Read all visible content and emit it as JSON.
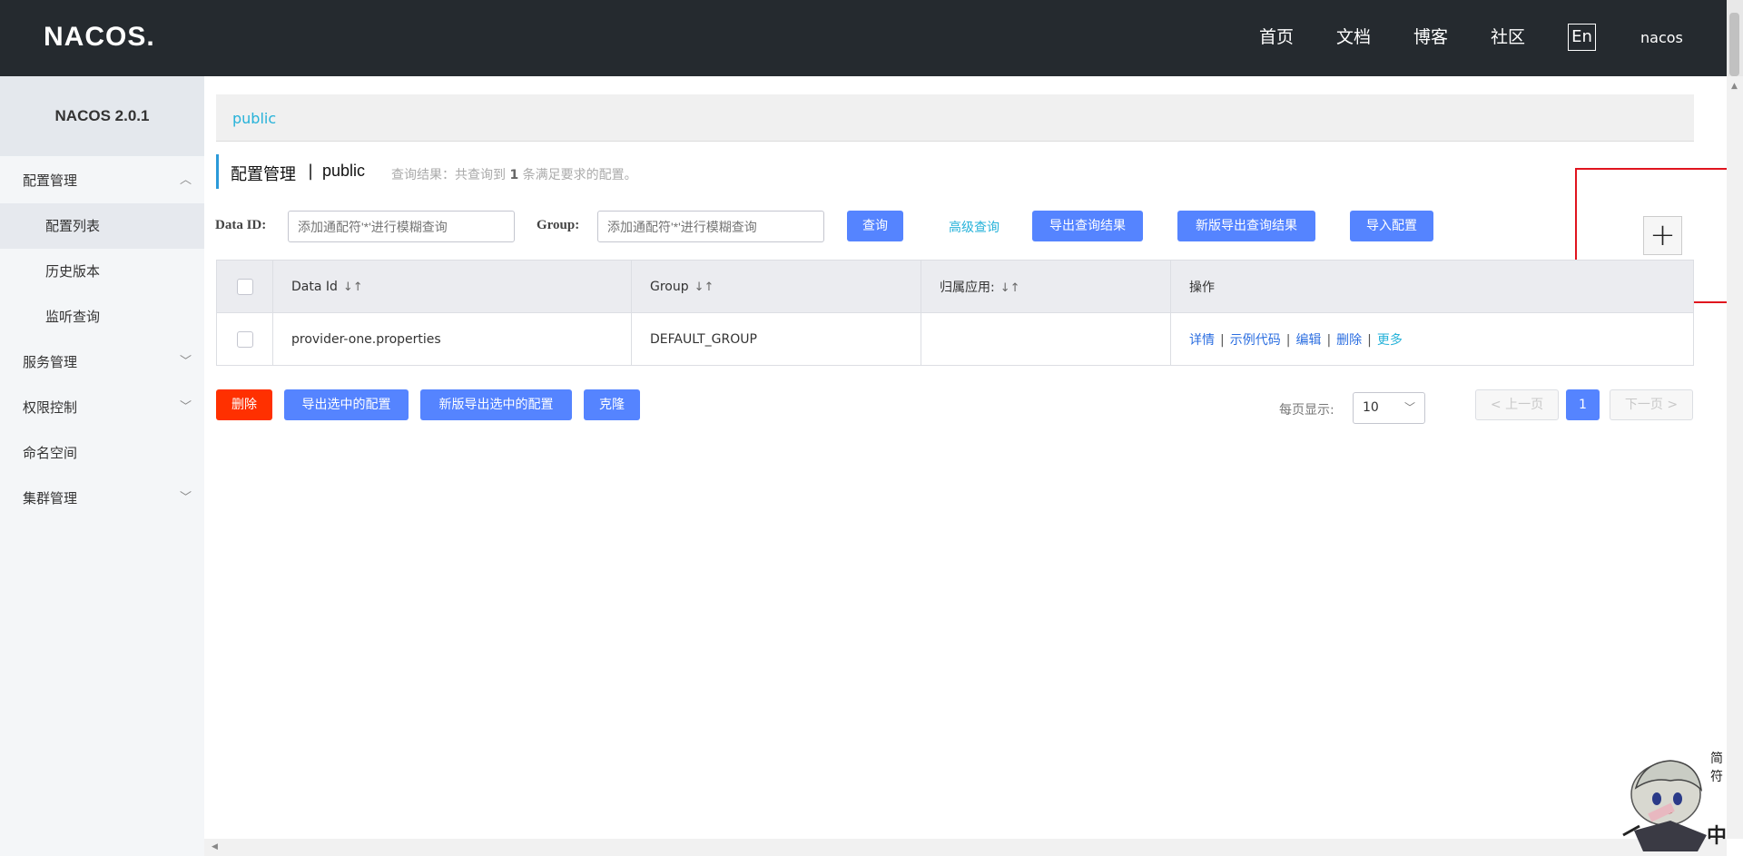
{
  "header": {
    "logo": "NACOS.",
    "nav": [
      "首页",
      "文档",
      "博客",
      "社区"
    ],
    "lang_button": "En",
    "user": "nacos"
  },
  "sidebar": {
    "title": "NACOS 2.0.1",
    "items": [
      {
        "label": "配置管理",
        "expanded": true
      },
      {
        "label": "配置列表",
        "sub": true,
        "active": true
      },
      {
        "label": "历史版本",
        "sub": true
      },
      {
        "label": "监听查询",
        "sub": true
      },
      {
        "label": "服务管理",
        "expanded": false
      },
      {
        "label": "权限控制",
        "expanded": false
      },
      {
        "label": "命名空间"
      },
      {
        "label": "集群管理",
        "expanded": false
      }
    ]
  },
  "breadcrumb": {
    "namespace": "public"
  },
  "title": {
    "main": "配置管理",
    "sep": "|",
    "namespace": "public",
    "info_prefix": "查询结果：共查询到",
    "info_count": "1",
    "info_suffix": "条满足要求的配置。"
  },
  "filters": {
    "data_id_label": "Data ID:",
    "data_id_placeholder": "添加通配符'*'进行模糊查询",
    "group_label": "Group:",
    "group_placeholder": "添加通配符'*'进行模糊查询"
  },
  "toolbar": {
    "search": "查询",
    "advanced": "高级查询",
    "export_results": "导出查询结果",
    "new_export_results": "新版导出查询结果",
    "import": "导入配置",
    "add": "+"
  },
  "table": {
    "headers": [
      "Data Id",
      "Group",
      "归属应用:",
      "操作"
    ],
    "rows": [
      {
        "data_id": "provider-one.properties",
        "group": "DEFAULT_GROUP",
        "app": ""
      }
    ],
    "ops": [
      "详情",
      "示例代码",
      "编辑",
      "删除",
      "更多"
    ]
  },
  "bulk": {
    "delete": "删除",
    "export_selected": "导出选中的配置",
    "new_export_selected": "新版导出选中的配置",
    "clone": "克隆"
  },
  "pagination": {
    "per_page_label": "每页显示:",
    "per_page_value": "10",
    "prev": "< 上一页",
    "current": "1",
    "next": "下一页 >"
  },
  "colors": {
    "header_bg": "#252a2f",
    "primary": "#5584ff",
    "danger": "#ff3000",
    "link": "#26b2d9",
    "highlight_box": "#e0141e"
  }
}
